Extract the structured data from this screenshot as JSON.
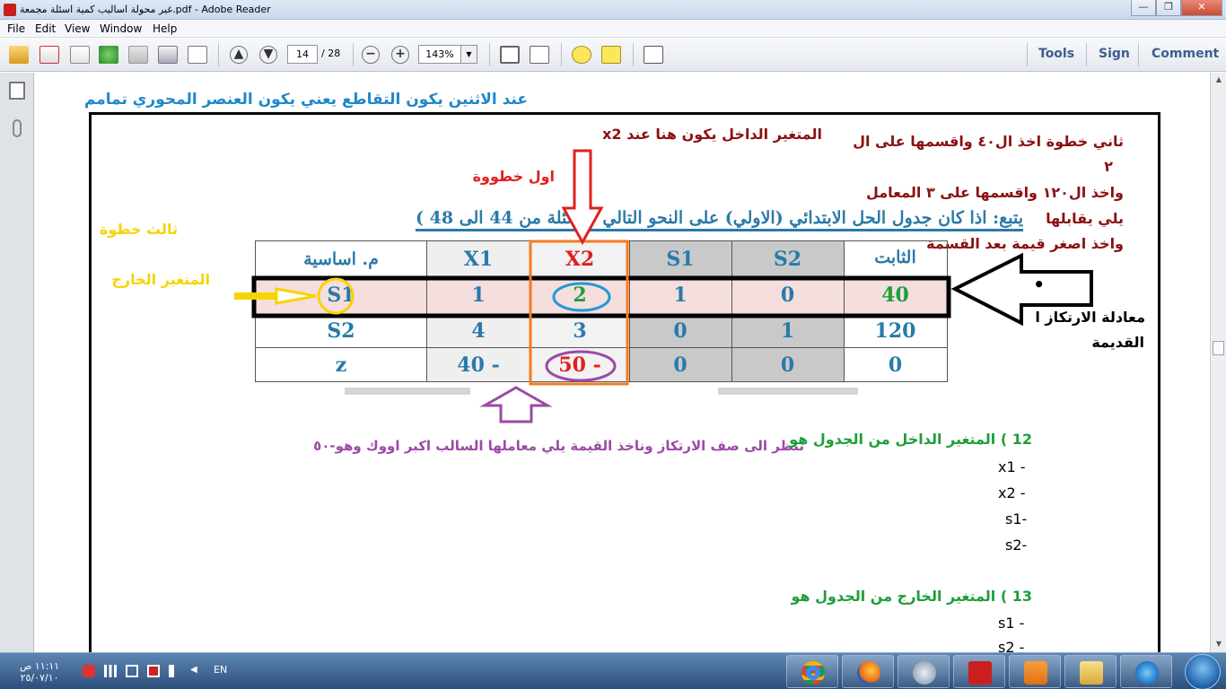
{
  "window": {
    "title": "غير محولة اساليب كمية اسئلة مجمعة.pdf - Adobe Reader",
    "minimize": "—",
    "maximize": "❐",
    "close": "✕"
  },
  "menu": {
    "items": [
      "File",
      "Edit",
      "View",
      "Window",
      "Help"
    ]
  },
  "toolbar": {
    "page_current": "14",
    "page_total": "/ 28",
    "zoom": "143%",
    "zoom_dropdown": "▼",
    "zoom_out": "−",
    "zoom_in": "+",
    "tools_label": "Tools",
    "sign_label": "Sign",
    "comment_label": "Comment"
  },
  "document": {
    "top_note": "عند الاثنين يكون التقاطع يعني يكون العنصر المحوري تمامم",
    "entering_var_note": "المتغير الداخل يكون هنا عند x2",
    "first_step": "اول خطووة",
    "second_step_lines": [
      "ثاني خطوة اخذ ال٤٠ واقسمها على ال",
      "٢",
      "واخذ ال١٢٠ واقسمها على ٣ المعامل",
      "يلي يقابلها",
      "واخذ اصغر قيمة بعد القسمة"
    ],
    "third_step": "ثالث خطوة",
    "leaving_var": "المتغير الخارج",
    "table_heading": "يتبع: اذا كان جدول الحل الابتدائي (الاولي) على النحو التالي للأسئلة من 44  الى 48 )",
    "pivot_row_dot": "•",
    "pivot_equation_lines": [
      "معادلة الارتكاز ا",
      "القديمة"
    ],
    "instruction_note": "ننظر الى صف الارتكاز وناخذ القيمة يلي معاملها السالب اكبر اووك وهو-٥٠",
    "q12": {
      "title": "12 ) المتغير الداخل من الجدول هو",
      "options": [
        "x1 -",
        "x2 -",
        "s1-",
        "s2-"
      ]
    },
    "q13": {
      "title": "13 ) المتغير الخارج من الجدول هو",
      "options": [
        "s1 -",
        "s2 -"
      ]
    }
  },
  "table": {
    "headers": [
      "م. اساسية",
      "X1",
      "X2",
      "S1",
      "S2",
      "الثابت"
    ],
    "rows": [
      [
        "S1",
        "1",
        "2",
        "1",
        "0",
        "40"
      ],
      [
        "S2",
        "4",
        "3",
        "0",
        "1",
        "120"
      ],
      [
        "z",
        "40 -",
        "50 -",
        "0",
        "0",
        "0"
      ]
    ]
  },
  "taskbar": {
    "clock_time": "١١:١١ ص",
    "clock_date": "٢٥/٠٧/١٠",
    "language": "EN"
  },
  "colors": {
    "table_text": "#2a7aa8",
    "highlight_orange": "#f47b20",
    "arrow_red": "#e02020",
    "annotation_yellow": "#f5d400",
    "annotation_purple": "#9b4aa6",
    "note_blue": "#1e88c8",
    "note_darkred": "#8b1010",
    "green_text": "#1e9e3a"
  }
}
